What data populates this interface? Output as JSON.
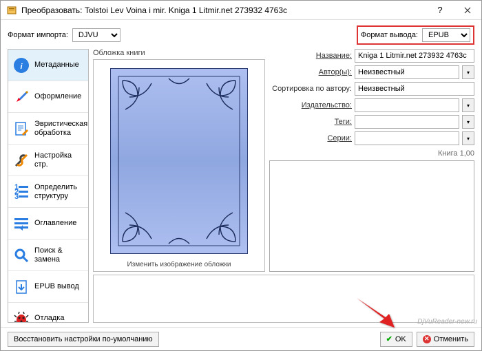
{
  "window": {
    "title": "Преобразовать: Tolstoi Lev Voina i mir. Kniga 1 Litmir.net 273932 4763c"
  },
  "formats": {
    "import_label": "Формат импорта:",
    "import_value": "DJVU",
    "output_label": "Формат вывода:",
    "output_value": "EPUB"
  },
  "sidebar": {
    "items": [
      {
        "label": "Метаданные",
        "icon": "info"
      },
      {
        "label": "Оформление",
        "icon": "brush"
      },
      {
        "label": "Эвристическая обработка",
        "icon": "page-edit"
      },
      {
        "label": "Настройка стр.",
        "icon": "wrench"
      },
      {
        "label": "Определить структуру",
        "icon": "numbers"
      },
      {
        "label": "Оглавление",
        "icon": "toc"
      },
      {
        "label": "Поиск & замена",
        "icon": "search"
      },
      {
        "label": "EPUB вывод",
        "icon": "page-out"
      },
      {
        "label": "Отладка",
        "icon": "bug"
      }
    ]
  },
  "cover": {
    "title": "Обложка книги",
    "change_label": "Изменить изображение обложки"
  },
  "fields": {
    "title": {
      "label": "Название:",
      "value": "Kniga 1 Litmir.net 273932 4763c"
    },
    "author": {
      "label": "Автор(ы):",
      "value": "Неизвестный"
    },
    "sort": {
      "label": "Сортировка по автору:",
      "value": "Неизвестный"
    },
    "publisher": {
      "label": "Издательство:",
      "value": ""
    },
    "tags": {
      "label": "Теги:",
      "value": ""
    },
    "series": {
      "label": "Серии:",
      "value": ""
    },
    "book_num": "Книга 1,00"
  },
  "footer": {
    "reset": "Восстановить настройки по-умолчанию",
    "ok": "OK",
    "cancel": "Отменить"
  },
  "watermark": "DjVuReader-new.ru"
}
